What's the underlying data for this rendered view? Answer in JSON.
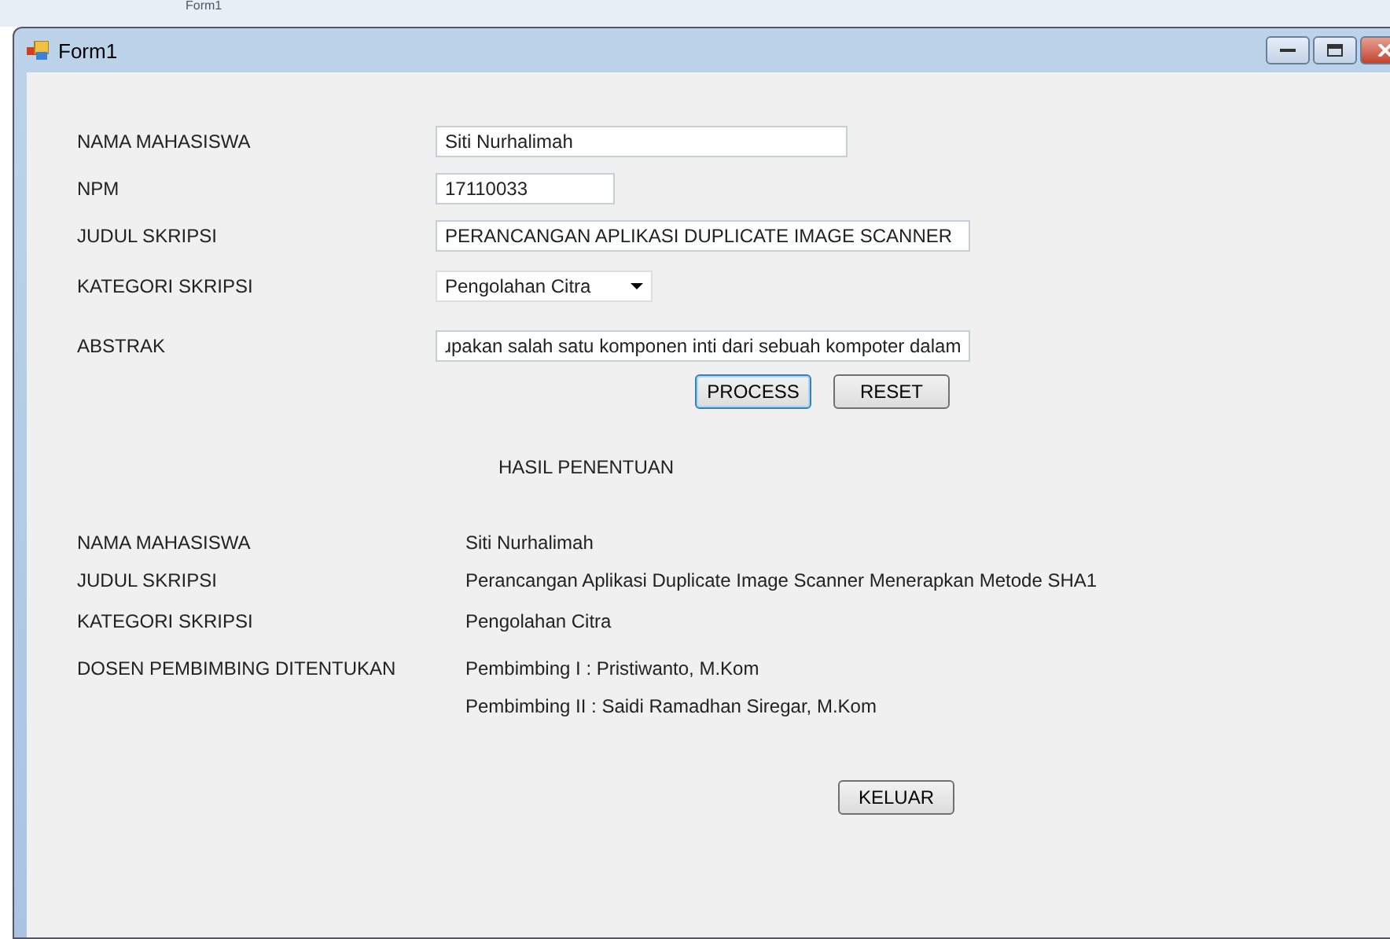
{
  "behind_window": {
    "title": "Form1"
  },
  "window": {
    "title": "Form1"
  },
  "form": [
    {
      "label": "NAMA MAHASISWA",
      "kind": "text",
      "value": "Siti Nurhalimah"
    },
    {
      "label": "NPM",
      "kind": "text",
      "value": "17110033"
    },
    {
      "label": "JUDUL SKRIPSI",
      "kind": "text",
      "value": "PERANCANGAN APLIKASI DUPLICATE IMAGE SCANNER"
    },
    {
      "label": "KATEGORI SKRIPSI",
      "kind": "combo",
      "value": "Pengolahan Citra"
    },
    {
      "label": "ABSTRAK",
      "kind": "text",
      "value": "ɹpakan salah satu komponen inti dari sebuah kompoter dalam"
    }
  ],
  "buttons": [
    {
      "label": "PROCESS",
      "focused": true
    },
    {
      "label": "RESET",
      "focused": false
    }
  ],
  "result_heading": "HASIL PENENTUAN",
  "results": [
    {
      "label": "NAMA MAHASISWA",
      "values": [
        "Siti Nurhalimah"
      ]
    },
    {
      "label": "JUDUL SKRIPSI",
      "values": [
        "Perancangan Aplikasi Duplicate Image Scanner Menerapkan Metode SHA1"
      ]
    },
    {
      "label": "KATEGORI SKRIPSI",
      "values": [
        "Pengolahan Citra"
      ]
    },
    {
      "label": "DOSEN PEMBIMBING DITENTUKAN",
      "values": [
        "Pembimbing I : Pristiwanto, M.Kom",
        "Pembimbing II : Saidi Ramadhan Siregar, M.Kom"
      ]
    }
  ],
  "exit_button": "KELUAR"
}
